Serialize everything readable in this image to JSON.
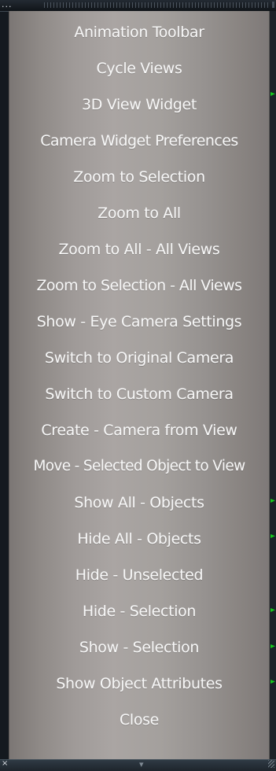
{
  "window": {
    "title_dots": "...",
    "drag_grip": "grip-icon"
  },
  "menu": {
    "items": [
      {
        "label": "Animation Toolbar",
        "has_submenu_marker": false
      },
      {
        "label": "Cycle Views",
        "has_submenu_marker": false
      },
      {
        "label": "3D View Widget",
        "has_submenu_marker": true
      },
      {
        "label": "Camera Widget Preferences",
        "has_submenu_marker": false
      },
      {
        "label": "Zoom to Selection",
        "has_submenu_marker": false
      },
      {
        "label": "Zoom to All",
        "has_submenu_marker": false
      },
      {
        "label": "Zoom to All - All Views",
        "has_submenu_marker": false
      },
      {
        "label": "Zoom to Selection - All  Views",
        "has_submenu_marker": false
      },
      {
        "label": "Show - Eye Camera Settings",
        "has_submenu_marker": false
      },
      {
        "label": "Switch to Original Camera",
        "has_submenu_marker": false
      },
      {
        "label": "Switch to Custom Camera",
        "has_submenu_marker": false
      },
      {
        "label": "Create - Camera from View",
        "has_submenu_marker": false
      },
      {
        "label": "Move - Selected Object to View",
        "has_submenu_marker": true
      },
      {
        "label": "Show All - Objects",
        "has_submenu_marker": true
      },
      {
        "label": "Hide All - Objects",
        "has_submenu_marker": false
      },
      {
        "label": "Hide - Unselected",
        "has_submenu_marker": true
      },
      {
        "label": "Hide - Selection",
        "has_submenu_marker": true
      },
      {
        "label": "Show - Selection",
        "has_submenu_marker": true
      },
      {
        "label": "Show Object Attributes",
        "has_submenu_marker": false
      },
      {
        "label": "Close",
        "has_submenu_marker": false
      }
    ]
  },
  "footer": {
    "left_glyph": "×",
    "center_glyph": "▾",
    "resize_icon": "resize-grip-icon"
  },
  "colors": {
    "menu_text": "#f7f7f7",
    "submenu_marker": "#17c71d",
    "window_bar": "#1d2229",
    "menu_background": "#a4a09d"
  }
}
